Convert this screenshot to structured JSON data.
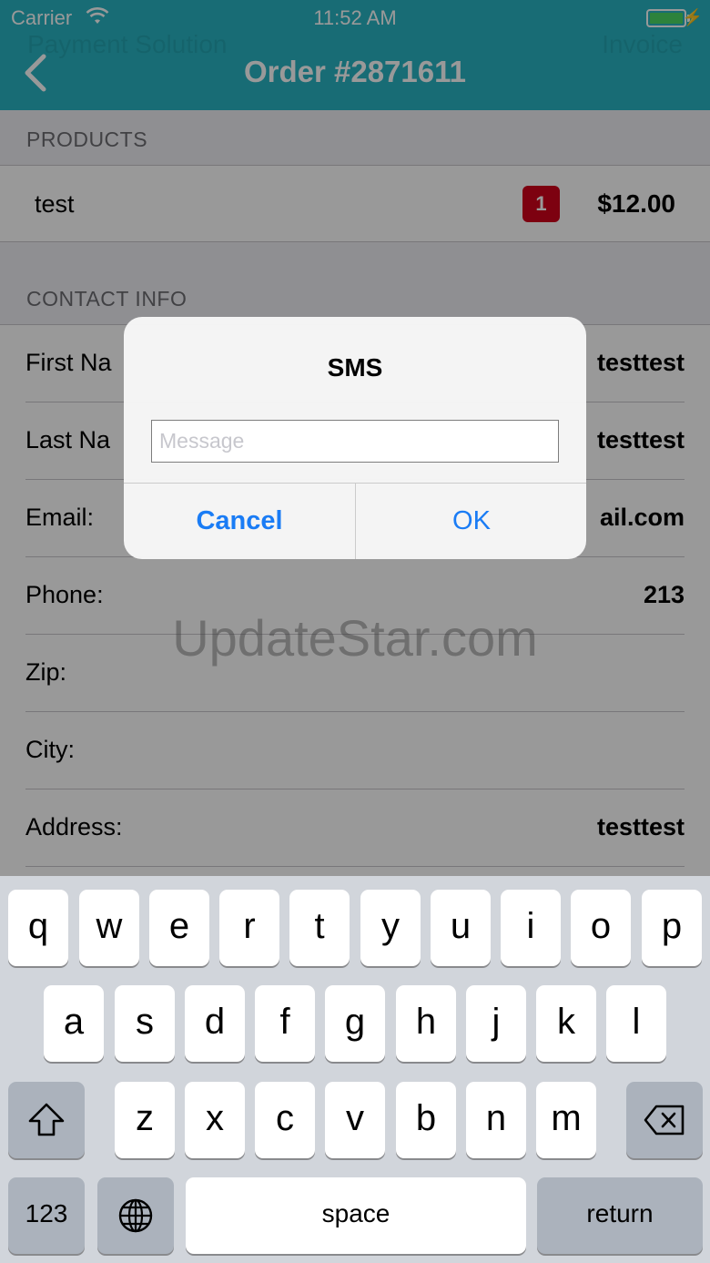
{
  "status": {
    "carrier": "Carrier",
    "time": "11:52 AM"
  },
  "nav": {
    "title": "Order #2871611",
    "ghost_left": "Payment Solution",
    "ghost_right": "Invoice"
  },
  "products": {
    "header": "PRODUCTS",
    "items": [
      {
        "name": "test",
        "quantity": "1",
        "price": "$12.00"
      }
    ]
  },
  "contact": {
    "header": "CONTACT INFO",
    "rows": [
      {
        "label": "First Na",
        "value": "testtest"
      },
      {
        "label": "Last Na",
        "value": "testtest"
      },
      {
        "label": "Email:",
        "value": "ail.com"
      },
      {
        "label": "Phone:",
        "value": "213"
      },
      {
        "label": "Zip:",
        "value": ""
      },
      {
        "label": "City:",
        "value": ""
      },
      {
        "label": "Address:",
        "value": "testtest"
      }
    ]
  },
  "alert": {
    "title": "SMS",
    "input_placeholder": "Message",
    "input_value": "",
    "cancel_label": "Cancel",
    "ok_label": "OK"
  },
  "watermark": "UpdateStar.com",
  "keyboard": {
    "row1": [
      "q",
      "w",
      "e",
      "r",
      "t",
      "y",
      "u",
      "i",
      "o",
      "p"
    ],
    "row2": [
      "a",
      "s",
      "d",
      "f",
      "g",
      "h",
      "j",
      "k",
      "l"
    ],
    "row3": [
      "z",
      "x",
      "c",
      "v",
      "b",
      "n",
      "m"
    ],
    "numbers_label": "123",
    "space_label": "space",
    "return_label": "return",
    "shift_icon": "shift-icon",
    "delete_icon": "delete-icon",
    "globe_icon": "globe-icon"
  },
  "colors": {
    "nav_bar": "#28b5c3",
    "alert_button": "#1a7cf5",
    "badge": "#d0021b",
    "battery": "#4cd964"
  }
}
